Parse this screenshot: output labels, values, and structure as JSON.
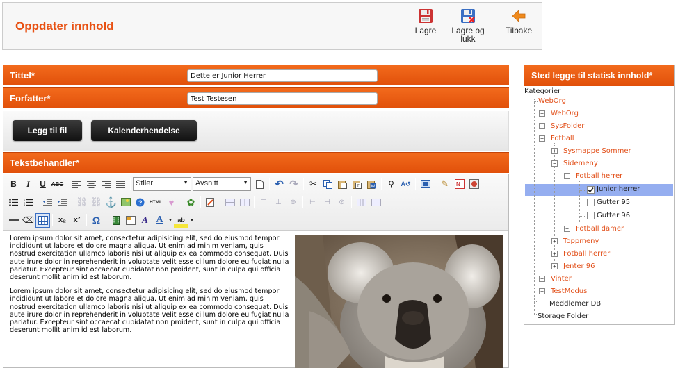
{
  "header": {
    "title": "Oppdater innhold",
    "buttons": [
      {
        "label": "Lagre",
        "icon": "floppy-save-icon"
      },
      {
        "label_line1": "Lagre og",
        "label_line2": "lukk",
        "icon": "floppy-save-close-icon"
      },
      {
        "label": "Tilbake",
        "icon": "arrow-back-icon"
      }
    ]
  },
  "form": {
    "title_label": "Tittel*",
    "title_value": "Dette er Junior Herrer",
    "author_label": "Forfatter*",
    "author_value": "Test Testesen",
    "add_file_button": "Legg til fil",
    "calendar_button": "Kalenderhendelse",
    "editor_label": "Tekstbehandler*"
  },
  "editor": {
    "style_select": "Stiler",
    "format_select": "Avsnitt",
    "paragraphs": [
      "Lorem ipsum dolor sit amet, consectetur adipisicing elit, sed do eiusmod tempor incididunt ut labore et dolore magna aliqua. Ut enim ad minim veniam, quis nostrud exercitation ullamco laboris nisi ut aliquip ex ea commodo consequat. Duis aute irure dolor in reprehenderit in voluptate velit esse cillum dolore eu fugiat nulla pariatur. Excepteur sint occaecat cupidatat non proident, sunt in culpa qui officia deserunt mollit anim id est laborum.",
      "Lorem ipsum dolor sit amet, consectetur adipisicing elit, sed do eiusmod tempor incididunt ut labore et dolore magna aliqua. Ut enim ad minim veniam, quis nostrud exercitation ullamco laboris nisi ut aliquip ex ea commodo consequat. Duis aute irure dolor in reprehenderit in voluptate velit esse cillum dolore eu fugiat nulla pariatur. Excepteur sint occaecat cupidatat non proident, sunt in culpa qui officia deserunt mollit anim id est laborum."
    ],
    "image": "koala-image"
  },
  "sidebar": {
    "title": "Sted legge til statisk innhold*",
    "tree": {
      "root": "Kategorier",
      "weborg": "WebOrg",
      "weborg_child": "WebOrg",
      "sysfolder": "SysFolder",
      "fotball": "Fotball",
      "sysmappe": "Sysmappe Sommer",
      "sidemeny": "Sidemeny",
      "fotball_herrer": "Fotball herrer",
      "junior_herrer": "Junior herrer",
      "gutter95": "Gutter 95",
      "gutter96": "Gutter 96",
      "fotball_damer": "Fotball damer",
      "toppmeny": "Toppmeny",
      "fotball_herrer2": "Fotball herrer",
      "jenter96": "Jenter 96",
      "vinter": "Vinter",
      "testmodus": "TestModus",
      "meddlemer": "Meddlemer DB",
      "storage": "Storage Folder"
    },
    "checked": {
      "junior_herrer": true,
      "gutter95": false,
      "gutter96": false
    }
  },
  "colors": {
    "accent": "#e85113",
    "bar": "#ef5f15",
    "selection": "#95aef0"
  }
}
